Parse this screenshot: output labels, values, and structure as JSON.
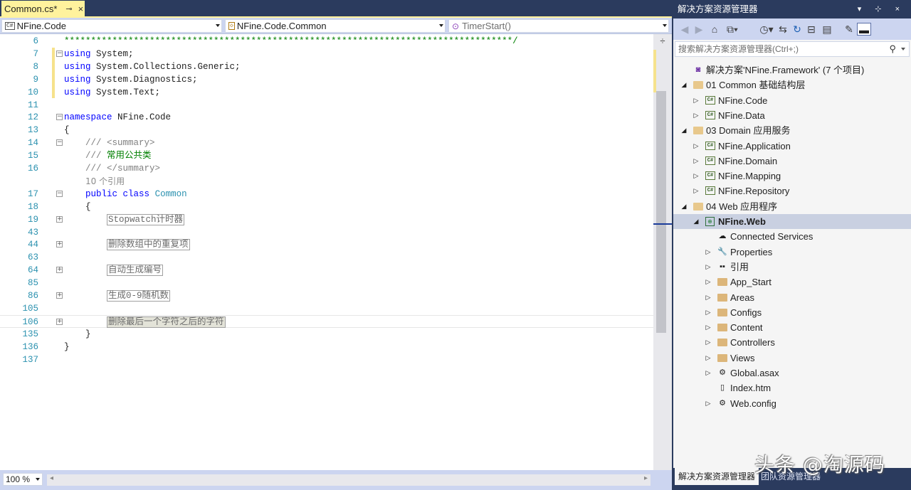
{
  "editor": {
    "tab": {
      "title": "Common.cs*",
      "pin_glyph": "⊸",
      "close_glyph": "×"
    },
    "navbar": {
      "project": "NFine.Code",
      "class_scope": "NFine.Code.Common",
      "member": "TimerStart()"
    },
    "zoom": "100 %",
    "lines": [
      {
        "n": "6",
        "html": "<span class=\"cmg\">************************************************************************************/</span>",
        "fold": ""
      },
      {
        "n": "7",
        "html": "<span class=\"kw\">using</span> System;",
        "fold": "−"
      },
      {
        "n": "8",
        "html": "<span class=\"kw\">using</span> System.Collections.Generic;",
        "fold": ""
      },
      {
        "n": "9",
        "html": "<span class=\"kw\">using</span> System.Diagnostics;",
        "fold": ""
      },
      {
        "n": "10",
        "html": "<span class=\"kw\">using</span> System.Text;",
        "fold": ""
      },
      {
        "n": "11",
        "html": "",
        "fold": ""
      },
      {
        "n": "12",
        "html": "<span class=\"kw\">namespace</span> NFine.Code",
        "fold": "−"
      },
      {
        "n": "13",
        "html": "{",
        "fold": ""
      },
      {
        "n": "14",
        "html": "    <span class=\"cm\">///</span> <span class=\"cm\">&lt;summary&gt;</span>",
        "fold": "−"
      },
      {
        "n": "15",
        "html": "    <span class=\"cm\">///</span> <span class=\"cmg\">常用公共类</span>",
        "fold": ""
      },
      {
        "n": "16",
        "html": "    <span class=\"cm\">///</span> <span class=\"cm\">&lt;/summary&gt;</span>",
        "fold": ""
      },
      {
        "n": "",
        "html": "    <span class=\"ref\">10 个引用</span>",
        "fold": ""
      },
      {
        "n": "17",
        "html": "    <span class=\"kw\">public</span> <span class=\"kw\">class</span> <span class=\"ty\">Common</span>",
        "fold": "−"
      },
      {
        "n": "18",
        "html": "    {",
        "fold": ""
      },
      {
        "n": "19",
        "html": "        <span class=\"collapsed\">Stopwatch计时器</span>",
        "fold": "+"
      },
      {
        "n": "43",
        "html": "",
        "fold": ""
      },
      {
        "n": "44",
        "html": "        <span class=\"collapsed\">删除数组中的重复项</span>",
        "fold": "+"
      },
      {
        "n": "63",
        "html": "",
        "fold": ""
      },
      {
        "n": "64",
        "html": "        <span class=\"collapsed\">自动生成编号</span>",
        "fold": "+"
      },
      {
        "n": "85",
        "html": "",
        "fold": ""
      },
      {
        "n": "86",
        "html": "        <span class=\"collapsed\">生成0-9随机数</span>",
        "fold": "+"
      },
      {
        "n": "105",
        "html": "",
        "fold": ""
      },
      {
        "n": "106",
        "html": "        <span class=\"collapsed sel\">删除最后一个字符之后的字符</span>",
        "fold": "+"
      },
      {
        "n": "135",
        "html": "    }",
        "fold": ""
      },
      {
        "n": "136",
        "html": "}",
        "fold": ""
      },
      {
        "n": "137",
        "html": "",
        "fold": ""
      }
    ]
  },
  "solution_explorer": {
    "title": "解决方案资源管理器",
    "title_buttons": "▾ ⊹ ×",
    "search_placeholder": "搜索解决方案资源管理器(Ctrl+;)",
    "toolbar_icons": [
      "back-icon",
      "forward-icon",
      "home-icon",
      "switch-views-icon",
      "history-icon",
      "sync-icon",
      "refresh-icon",
      "collapse-all-icon",
      "show-all-files-icon",
      "properties-wrench-icon",
      "preview-icon"
    ],
    "tree": [
      {
        "depth": 0,
        "exp": "",
        "icon": "solution",
        "label": "解决方案'NFine.Framework' (7 个项目)",
        "bold": false
      },
      {
        "depth": 0,
        "exp": "◢",
        "icon": "folder-open",
        "label": "01 Common 基础结构层",
        "bold": false
      },
      {
        "depth": 1,
        "exp": "▷",
        "icon": "csproj",
        "label": "NFine.Code",
        "bold": false
      },
      {
        "depth": 1,
        "exp": "▷",
        "icon": "csproj",
        "label": "NFine.Data",
        "bold": false
      },
      {
        "depth": 0,
        "exp": "◢",
        "icon": "folder-open",
        "label": "03 Domain 应用服务",
        "bold": false
      },
      {
        "depth": 1,
        "exp": "▷",
        "icon": "csproj",
        "label": "NFine.Application",
        "bold": false
      },
      {
        "depth": 1,
        "exp": "▷",
        "icon": "csproj",
        "label": "NFine.Domain",
        "bold": false
      },
      {
        "depth": 1,
        "exp": "▷",
        "icon": "csproj",
        "label": "NFine.Mapping",
        "bold": false
      },
      {
        "depth": 1,
        "exp": "▷",
        "icon": "csproj",
        "label": "NFine.Repository",
        "bold": false
      },
      {
        "depth": 0,
        "exp": "◢",
        "icon": "folder-open",
        "label": "04 Web 应用程序",
        "bold": false
      },
      {
        "depth": 1,
        "exp": "◢",
        "icon": "webproj",
        "label": "NFine.Web",
        "bold": true,
        "selected": true
      },
      {
        "depth": 2,
        "exp": "",
        "icon": "connected",
        "label": "Connected Services",
        "bold": false
      },
      {
        "depth": 2,
        "exp": "▷",
        "icon": "wrench",
        "label": "Properties",
        "bold": false
      },
      {
        "depth": 2,
        "exp": "▷",
        "icon": "refs",
        "label": "引用",
        "bold": false
      },
      {
        "depth": 2,
        "exp": "▷",
        "icon": "folder",
        "label": "App_Start",
        "bold": false
      },
      {
        "depth": 2,
        "exp": "▷",
        "icon": "folder",
        "label": "Areas",
        "bold": false
      },
      {
        "depth": 2,
        "exp": "▷",
        "icon": "folder",
        "label": "Configs",
        "bold": false
      },
      {
        "depth": 2,
        "exp": "▷",
        "icon": "folder",
        "label": "Content",
        "bold": false
      },
      {
        "depth": 2,
        "exp": "▷",
        "icon": "folder",
        "label": "Controllers",
        "bold": false
      },
      {
        "depth": 2,
        "exp": "▷",
        "icon": "folder",
        "label": "Views",
        "bold": false
      },
      {
        "depth": 2,
        "exp": "▷",
        "icon": "asax",
        "label": "Global.asax",
        "bold": false
      },
      {
        "depth": 2,
        "exp": "",
        "icon": "htm",
        "label": "Index.htm",
        "bold": false
      },
      {
        "depth": 2,
        "exp": "▷",
        "icon": "config",
        "label": "Web.config",
        "bold": false
      }
    ],
    "bottom_tabs": {
      "active": "解决方案资源管理器",
      "inactive": "团队资源管理器"
    }
  },
  "watermark": "头条 @淘源码"
}
